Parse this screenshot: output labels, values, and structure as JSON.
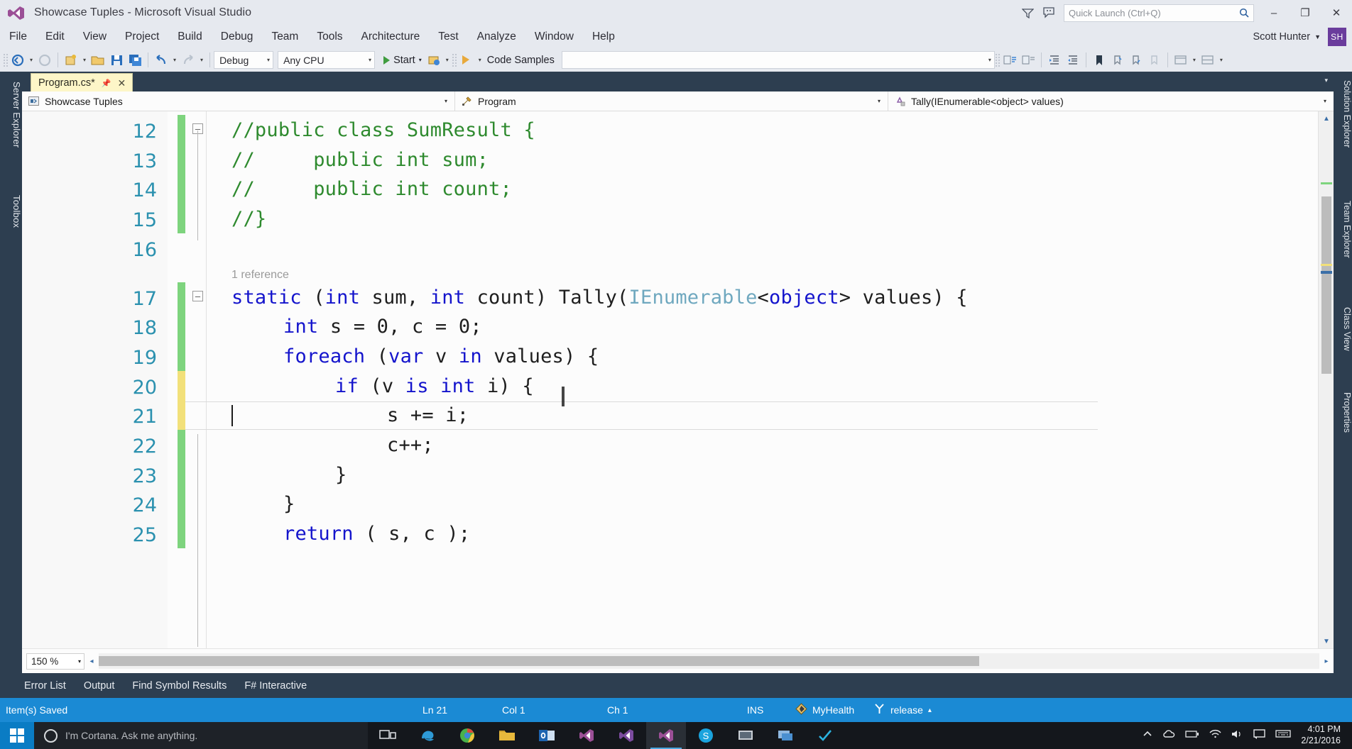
{
  "window": {
    "title": "Showcase Tuples - Microsoft Visual Studio",
    "logo_icon": "visual-studio-logo-icon",
    "minimize_label": "–",
    "maximize_label": "❐",
    "close_label": "✕",
    "filter_icon": "filter-icon",
    "feedback_icon": "feedback-smiley-icon"
  },
  "quick_launch": {
    "placeholder": "Quick Launch (Ctrl+Q)",
    "search_icon": "search-icon"
  },
  "menu": {
    "items": [
      {
        "label": "File"
      },
      {
        "label": "Edit"
      },
      {
        "label": "View"
      },
      {
        "label": "Project"
      },
      {
        "label": "Build"
      },
      {
        "label": "Debug"
      },
      {
        "label": "Team"
      },
      {
        "label": "Tools"
      },
      {
        "label": "Architecture"
      },
      {
        "label": "Test"
      },
      {
        "label": "Analyze"
      },
      {
        "label": "Window"
      },
      {
        "label": "Help"
      }
    ],
    "user_name": "Scott Hunter",
    "user_caret": "▼",
    "avatar_initials": "SH"
  },
  "toolbar": {
    "back_icon": "navigate-back-icon",
    "forward_icon": "navigate-forward-icon",
    "new_project_icon": "new-project-icon",
    "open_file_icon": "open-file-icon",
    "save_icon": "save-icon",
    "save_all_icon": "save-all-icon",
    "undo_icon": "undo-arrow-icon",
    "redo_icon": "redo-arrow-icon",
    "config_value": "Debug",
    "platform_value": "Any CPU",
    "start_label": "Start",
    "start_icon": "play-triangle-icon",
    "start_caret": "▾",
    "attach_icon": "attach-to-process-icon",
    "codelens_icon": "code-samples-icon",
    "code_samples_label": "Code Samples",
    "search_combo_value": "",
    "extra_icons": [
      "comment-icon",
      "uncomment-icon",
      "increase-indent-icon",
      "decrease-indent-icon",
      "bookmark-icon",
      "prev-bookmark-icon",
      "next-bookmark-icon",
      "clear-bookmarks-icon",
      "toggle-all-bookmarks-icon",
      "new-window-icon",
      "split-window-icon"
    ],
    "caret_glyph": "▾"
  },
  "left_dock": {
    "items": [
      {
        "label": "Server Explorer"
      },
      {
        "label": "Toolbox"
      }
    ]
  },
  "right_dock": {
    "items": [
      {
        "label": "Solution Explorer"
      },
      {
        "label": "Team Explorer"
      },
      {
        "label": "Class View"
      },
      {
        "label": "Properties"
      }
    ]
  },
  "document_tab": {
    "name": "Program.cs*",
    "pin_icon": "pin-icon",
    "close_icon": "close-icon",
    "overflow_caret": "▾"
  },
  "navbar": {
    "project": {
      "label": "Showcase Tuples",
      "icon": "project-icon",
      "caret": "▾"
    },
    "type": {
      "label": "Program",
      "icon": "class-wrench-icon",
      "caret": "▾"
    },
    "member": {
      "label": "Tally(IEnumerable<object> values)",
      "icon": "method-icon",
      "caret": "▾"
    }
  },
  "editor": {
    "codelens_text": "1 reference",
    "zoom_level": "150 %",
    "zoom_caret": "▾",
    "fold_collapse_glyph": "–",
    "lines": [
      {
        "number": "12",
        "indent": 0,
        "fold": "collapse",
        "change": "green",
        "tokens": [
          {
            "t": "//public class SumResult {",
            "c": "cm"
          }
        ]
      },
      {
        "number": "13",
        "indent": 0,
        "change": "green",
        "tokens": [
          {
            "t": "//     public int sum;",
            "c": "cm"
          }
        ]
      },
      {
        "number": "14",
        "indent": 0,
        "change": "green",
        "tokens": [
          {
            "t": "//     public int count;",
            "c": "cm"
          }
        ]
      },
      {
        "number": "15",
        "indent": 0,
        "change": "green",
        "tokens": [
          {
            "t": "//}",
            "c": "cm"
          }
        ]
      },
      {
        "number": "16",
        "indent": 0,
        "change": "none",
        "tokens": []
      },
      {
        "number": "17",
        "indent": 0,
        "fold": "collapse",
        "change": "green",
        "codelens": "1 reference",
        "tokens": [
          {
            "t": "static",
            "c": "k"
          },
          {
            "t": " (",
            "c": "pl"
          },
          {
            "t": "int",
            "c": "k"
          },
          {
            "t": " sum, ",
            "c": "pl"
          },
          {
            "t": "int",
            "c": "k"
          },
          {
            "t": " count) Tally(",
            "c": "pl"
          },
          {
            "t": "IEnumerable",
            "c": "ty"
          },
          {
            "t": "<",
            "c": "pl"
          },
          {
            "t": "object",
            "c": "k"
          },
          {
            "t": "> values) {",
            "c": "pl"
          }
        ]
      },
      {
        "number": "18",
        "indent": 1,
        "change": "green",
        "tokens": [
          {
            "t": "int",
            "c": "k"
          },
          {
            "t": " s = 0, c = 0;",
            "c": "pl"
          }
        ]
      },
      {
        "number": "19",
        "indent": 1,
        "change": "green",
        "tokens": [
          {
            "t": "foreach",
            "c": "k"
          },
          {
            "t": " (",
            "c": "pl"
          },
          {
            "t": "var",
            "c": "k"
          },
          {
            "t": " v ",
            "c": "pl"
          },
          {
            "t": "in",
            "c": "k"
          },
          {
            "t": " values) {",
            "c": "pl"
          }
        ]
      },
      {
        "number": "20",
        "indent": 2,
        "change": "yellow",
        "tokens": [
          {
            "t": "if",
            "c": "k"
          },
          {
            "t": " (v ",
            "c": "pl"
          },
          {
            "t": "is",
            "c": "k"
          },
          {
            "t": " ",
            "c": "pl"
          },
          {
            "t": "int",
            "c": "k"
          },
          {
            "t": " i) {",
            "c": "pl"
          }
        ]
      },
      {
        "number": "21",
        "indent": 3,
        "change": "yellow",
        "current": true,
        "tokens": [
          {
            "t": "s += i;",
            "c": "pl"
          }
        ]
      },
      {
        "number": "22",
        "indent": 3,
        "change": "green",
        "tokens": [
          {
            "t": "c++;",
            "c": "pl"
          }
        ]
      },
      {
        "number": "23",
        "indent": 2,
        "change": "green",
        "tokens": [
          {
            "t": "}",
            "c": "pl"
          }
        ]
      },
      {
        "number": "24",
        "indent": 1,
        "change": "green",
        "tokens": [
          {
            "t": "}",
            "c": "pl"
          }
        ]
      },
      {
        "number": "25",
        "indent": 1,
        "change": "green",
        "tokens": [
          {
            "t": "return",
            "c": "k"
          },
          {
            "t": " ( s, c );",
            "c": "pl"
          }
        ]
      }
    ]
  },
  "panel_tabs": [
    {
      "label": "Error List"
    },
    {
      "label": "Output"
    },
    {
      "label": "Find Symbol Results"
    },
    {
      "label": "F# Interactive"
    }
  ],
  "status_bar": {
    "message": "Item(s) Saved",
    "line": "Ln 21",
    "column": "Col 1",
    "character": "Ch 1",
    "insert_mode": "INS",
    "repository": "MyHealth",
    "repository_icon": "source-control-icon",
    "branch": "release",
    "branch_icon": "branch-icon",
    "branch_caret": "▴"
  },
  "taskbar": {
    "start_icon": "windows-start-icon",
    "cortana_placeholder": "I'm Cortana. Ask me anything.",
    "cortana_icon": "cortana-circle-icon",
    "apps": [
      {
        "name": "task-view-icon"
      },
      {
        "name": "edge-browser-icon"
      },
      {
        "name": "chrome-browser-icon"
      },
      {
        "name": "file-explorer-icon"
      },
      {
        "name": "outlook-icon"
      },
      {
        "name": "visual-studio-icon-1"
      },
      {
        "name": "visual-studio-icon-2"
      },
      {
        "name": "visual-studio-icon-active",
        "active": true
      },
      {
        "name": "skype-icon"
      },
      {
        "name": "hyper-v-icon"
      },
      {
        "name": "remote-desktop-icon"
      },
      {
        "name": "onenote-check-icon"
      }
    ],
    "tray_icons": [
      "show-hidden-icons-caret",
      "onedrive-icon",
      "battery-icon",
      "network-icon",
      "volume-icon",
      "action-center-icon",
      "keyboard-icon"
    ],
    "clock_time": "4:01 PM",
    "clock_date": "2/21/2016"
  },
  "colors": {
    "vs_blue_chrome": "#2d3e50",
    "status_blue": "#1b8ad4",
    "tab_yellow": "#fdf6c8",
    "keyword_blue": "#1414cc",
    "comment_green": "#2e8a2e",
    "type_teal": "#6fa8bf",
    "linenum_blue": "#2b91af",
    "change_green": "#7ed47e",
    "change_yellow": "#f2e07a",
    "accent_purple": "#6a3c9c"
  }
}
